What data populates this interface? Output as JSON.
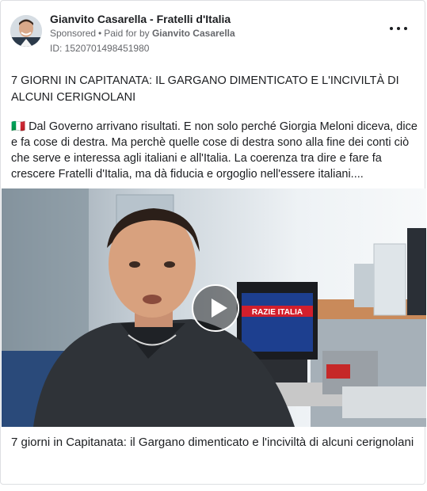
{
  "post": {
    "page_name": "Gianvito Casarella - Fratelli d'Italia",
    "sponsored_label": "Sponsored",
    "separator": "•",
    "paid_for_prefix": "Paid for by",
    "payer": "Gianvito Casarella",
    "ad_id": "ID: 1520701498451980",
    "more_icon": "more-horizontal-icon",
    "title": "7 GIORNI IN CAPITANATA: IL GARGANO DIMENTICATO E L'INCIVILTÀ DI ALCUNI CERIGNOLANI",
    "body": "🇮🇹 Dal Governo arrivano risultati. E non solo perché Giorgia Meloni diceva, dice e fa cose di destra. Ma perchè quelle cose di destra sono alla fine dei conti ciò che serve e interessa agli italiani e all'Italia. La coerenza tra dire e fare fa crescere Fratelli d'Italia, ma dà fiducia e orgoglio nell'essere italiani....",
    "video": {
      "play_icon": "play-icon",
      "tv_text": "RAZIE ITALIA"
    },
    "caption": "7 giorni in Capitanata: il Gargano dimenticato e l'inciviltà di alcuni cerignolani"
  },
  "colors": {
    "text": "#1c1e21",
    "secondary": "#65676b",
    "border": "#dddfe2"
  }
}
